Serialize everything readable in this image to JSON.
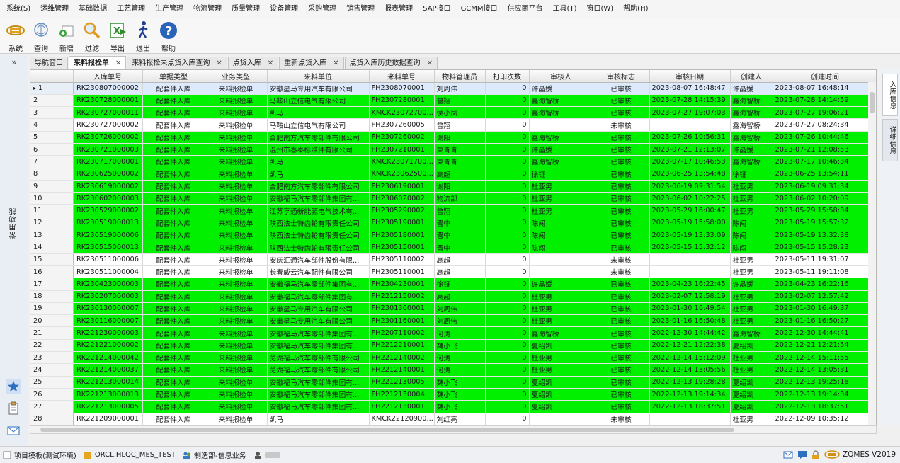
{
  "menu": [
    "系统(S)",
    "运维管理",
    "基础数据",
    "工艺管理",
    "生产管理",
    "物流管理",
    "质量管理",
    "设备管理",
    "采购管理",
    "销售管理",
    "报表管理",
    "SAP接口",
    "GCMM接口",
    "供应商平台",
    "工具(T)",
    "窗口(W)",
    "帮助(H)"
  ],
  "toolbar": [
    {
      "label": "系统",
      "icon": "system-icon"
    },
    {
      "label": "查询",
      "icon": "query-icon"
    },
    {
      "label": "新增",
      "icon": "add-icon"
    },
    {
      "label": "过滤",
      "icon": "filter-icon"
    },
    {
      "label": "导出",
      "icon": "export-icon"
    },
    {
      "label": "退出",
      "icon": "exit-icon"
    },
    {
      "label": "帮助",
      "icon": "help-icon"
    }
  ],
  "sidebar": {
    "expand": "»",
    "title": "常用功能"
  },
  "tabs": [
    {
      "label": "导航窗口",
      "closable": false,
      "active": false
    },
    {
      "label": "来料报检单",
      "closable": true,
      "active": true
    },
    {
      "label": "来料报检未点货入库查询",
      "closable": true,
      "active": false
    },
    {
      "label": "点货入库",
      "closable": true,
      "active": false
    },
    {
      "label": "重新点货入库",
      "closable": true,
      "active": false
    },
    {
      "label": "点货入库历史数据查询",
      "closable": true,
      "active": false
    }
  ],
  "grid": {
    "columns": [
      "",
      "入库单号",
      "单据类型",
      "业务类型",
      "来料单位",
      "来料单号",
      "物料管理员",
      "打印次数",
      "审核人",
      "审核标志",
      "审核日期",
      "创建人",
      "创建时间"
    ],
    "rows": [
      {
        "n": "1",
        "id": "RK230807000002",
        "type": "配套件入库",
        "biz": "来料报检单",
        "unit": "安徽星马专用汽车有限公司",
        "src": "FH2308070001",
        "mgr": "刘周伟",
        "prints": "0",
        "auditor": "许晶媛",
        "flag": "已审核",
        "adate": "2023-08-07 16:48:47",
        "creator": "许晶媛",
        "ctime": "2023-08-07 16:48:14",
        "state": "selected"
      },
      {
        "n": "2",
        "id": "RK230728000001",
        "type": "配套件入库",
        "biz": "来料报检单",
        "unit": "马鞍山立信电气有限公司",
        "src": "FH2307280001",
        "mgr": "曾翔",
        "prints": "0",
        "auditor": "鑫海智桥",
        "flag": "已审核",
        "adate": "2023-07-28 14:15:39",
        "creator": "鑫海智桥",
        "ctime": "2023-07-28 14:14:59",
        "state": "green"
      },
      {
        "n": "3",
        "id": "RK230727000011",
        "type": "配套件入库",
        "biz": "来料报检单",
        "unit": "凯马",
        "src": "KMCK23072700...",
        "mgr": "侯小凤",
        "prints": "0",
        "auditor": "鑫海智桥",
        "flag": "已审核",
        "adate": "2023-07-27 19:07:03",
        "creator": "鑫海智桥",
        "ctime": "2023-07-27 19:06:21",
        "state": "green"
      },
      {
        "n": "4",
        "id": "RK230727000002",
        "type": "配套件入库",
        "biz": "来料报检单",
        "unit": "马鞍山立信电气有限公司",
        "src": "FH2307260005",
        "mgr": "曾翔",
        "prints": "0",
        "auditor": "",
        "flag": "未审核",
        "adate": "",
        "creator": "鑫海智桥",
        "ctime": "2023-07-27 08:24:34",
        "state": "white"
      },
      {
        "n": "5",
        "id": "RK230726000002",
        "type": "配套件入库",
        "biz": "来料报检单",
        "unit": "合肥南方汽车零部件有限公司",
        "src": "FH2307260002",
        "mgr": "谢阳",
        "prints": "0",
        "auditor": "鑫海智桥",
        "flag": "已审核",
        "adate": "2023-07-26 10:56:31",
        "creator": "鑫海智桥",
        "ctime": "2023-07-26 10:44:46",
        "state": "green"
      },
      {
        "n": "6",
        "id": "RK230721000003",
        "type": "配套件入库",
        "biz": "来料报检单",
        "unit": "温州市春泰标准件有限公司",
        "src": "FH2307210001",
        "mgr": "束青青",
        "prints": "0",
        "auditor": "许晶媛",
        "flag": "已审核",
        "adate": "2023-07-21 12:13:07",
        "creator": "许晶媛",
        "ctime": "2023-07-21 12:08:53",
        "state": "green"
      },
      {
        "n": "7",
        "id": "RK230717000001",
        "type": "配套件入库",
        "biz": "来料报检单",
        "unit": "凯马",
        "src": "KMCK23071700...",
        "mgr": "束青青",
        "prints": "0",
        "auditor": "鑫海智桥",
        "flag": "已审核",
        "adate": "2023-07-17 10:46:53",
        "creator": "鑫海智桥",
        "ctime": "2023-07-17 10:46:34",
        "state": "green"
      },
      {
        "n": "8",
        "id": "RK230625000002",
        "type": "配套件入库",
        "biz": "来料报检单",
        "unit": "凯马",
        "src": "KMCK23062500...",
        "mgr": "高超",
        "prints": "0",
        "auditor": "徐钲",
        "flag": "已审核",
        "adate": "2023-06-25 13:54:48",
        "creator": "徐钲",
        "ctime": "2023-06-25 13:54:11",
        "state": "green"
      },
      {
        "n": "9",
        "id": "RK230619000002",
        "type": "配套件入库",
        "biz": "来料报检单",
        "unit": "合肥南方汽车零部件有限公司",
        "src": "FH2306190001",
        "mgr": "谢阳",
        "prints": "0",
        "auditor": "杜亚男",
        "flag": "已审核",
        "adate": "2023-06-19 09:31:54",
        "creator": "杜亚男",
        "ctime": "2023-06-19 09:31:34",
        "state": "green"
      },
      {
        "n": "10",
        "id": "RK230602000003",
        "type": "配套件入库",
        "biz": "来料报检单",
        "unit": "安徽福马汽车零部件集团有...",
        "src": "FH2306020002",
        "mgr": "物流部",
        "prints": "0",
        "auditor": "杜亚男",
        "flag": "已审核",
        "adate": "2023-06-02 10:22:25",
        "creator": "杜亚男",
        "ctime": "2023-06-02 10:20:09",
        "state": "green"
      },
      {
        "n": "11",
        "id": "RK230529000002",
        "type": "配套件入库",
        "biz": "来料报检单",
        "unit": "江苏亨通新能源电气技术有...",
        "src": "FH2305290002",
        "mgr": "曾翔",
        "prints": "0",
        "auditor": "杜亚男",
        "flag": "已审核",
        "adate": "2023-05-29 16:00:47",
        "creator": "杜亚男",
        "ctime": "2023-05-29 15:58:34",
        "state": "green"
      },
      {
        "n": "12",
        "id": "RK230519000013",
        "type": "配套件入库",
        "biz": "来料报检单",
        "unit": "陕西法士特齿轮有限责任公司",
        "src": "FH2305190001",
        "mgr": "晋中",
        "prints": "0",
        "auditor": "陈闯",
        "flag": "已审核",
        "adate": "2023-05-19 15:58:00",
        "creator": "陈闯",
        "ctime": "2023-05-19 15:57:32",
        "state": "green"
      },
      {
        "n": "13",
        "id": "RK230519000006",
        "type": "配套件入库",
        "biz": "来料报检单",
        "unit": "陕西法士特齿轮有限责任公司",
        "src": "FH2305180001",
        "mgr": "晋中",
        "prints": "0",
        "auditor": "陈闯",
        "flag": "已审核",
        "adate": "2023-05-19 13:33:09",
        "creator": "陈闯",
        "ctime": "2023-05-19 13:32:38",
        "state": "green"
      },
      {
        "n": "14",
        "id": "RK230515000013",
        "type": "配套件入库",
        "biz": "来料报检单",
        "unit": "陕西法士特齿轮有限责任公司",
        "src": "FH2305150001",
        "mgr": "晋中",
        "prints": "0",
        "auditor": "陈闯",
        "flag": "已审核",
        "adate": "2023-05-15 15:32:12",
        "creator": "陈闯",
        "ctime": "2023-05-15 15:28:23",
        "state": "green"
      },
      {
        "n": "15",
        "id": "RK230511000006",
        "type": "配套件入库",
        "biz": "来料报检单",
        "unit": "安庆汇通汽车部件股份有限...",
        "src": "FH2305110002",
        "mgr": "高超",
        "prints": "0",
        "auditor": "",
        "flag": "未审核",
        "adate": "",
        "creator": "杜亚男",
        "ctime": "2023-05-11 19:31:07",
        "state": "white"
      },
      {
        "n": "16",
        "id": "RK230511000004",
        "type": "配套件入库",
        "biz": "来料报检单",
        "unit": "长春威云汽车配件有限公司",
        "src": "FH2305110001",
        "mgr": "高超",
        "prints": "0",
        "auditor": "",
        "flag": "未审核",
        "adate": "",
        "creator": "杜亚男",
        "ctime": "2023-05-11 19:11:08",
        "state": "white"
      },
      {
        "n": "17",
        "id": "RK230423000003",
        "type": "配套件入库",
        "biz": "来料报检单",
        "unit": "安徽福马汽车零部件集团有...",
        "src": "FH2304230001",
        "mgr": "徐钲",
        "prints": "0",
        "auditor": "许晶媛",
        "flag": "已审核",
        "adate": "2023-04-23 16:22:45",
        "creator": "许晶媛",
        "ctime": "2023-04-23 16:22:16",
        "state": "green"
      },
      {
        "n": "18",
        "id": "RK230207000003",
        "type": "配套件入库",
        "biz": "来料报检单",
        "unit": "安徽福马汽车零部件集团有...",
        "src": "FH2212150002",
        "mgr": "高超",
        "prints": "0",
        "auditor": "杜亚男",
        "flag": "已审核",
        "adate": "2023-02-07 12:58:19",
        "creator": "杜亚男",
        "ctime": "2023-02-07 12:57:42",
        "state": "green"
      },
      {
        "n": "19",
        "id": "RK230130000007",
        "type": "配套件入库",
        "biz": "来料报检单",
        "unit": "安徽星马专用汽车有限公司",
        "src": "FH2301300001",
        "mgr": "刘周伟",
        "prints": "0",
        "auditor": "杜亚男",
        "flag": "已审核",
        "adate": "2023-01-30 16:49:54",
        "creator": "杜亚男",
        "ctime": "2023-01-30 16:49:37",
        "state": "green"
      },
      {
        "n": "20",
        "id": "RK230116000007",
        "type": "配套件入库",
        "biz": "来料报检单",
        "unit": "安徽星马专用汽车有限公司",
        "src": "FH2301160001",
        "mgr": "刘周伟",
        "prints": "0",
        "auditor": "杜亚男",
        "flag": "已审核",
        "adate": "2023-01-16 16:50:48",
        "creator": "杜亚男",
        "ctime": "2023-01-16 16:50:27",
        "state": "green"
      },
      {
        "n": "21",
        "id": "RK221230000003",
        "type": "配套件入库",
        "biz": "来料报检单",
        "unit": "安徽福马汽车零部件集团有...",
        "src": "FH2207110002",
        "mgr": "何涛",
        "prints": "0",
        "auditor": "鑫海智桥",
        "flag": "已审核",
        "adate": "2022-12-30 14:44:42",
        "creator": "鑫海智桥",
        "ctime": "2022-12-30 14:44:41",
        "state": "green"
      },
      {
        "n": "22",
        "id": "RK221221000002",
        "type": "配套件入库",
        "biz": "来料报检单",
        "unit": "安徽福马汽车零部件集团有...",
        "src": "FH2212210001",
        "mgr": "魏小飞",
        "prints": "0",
        "auditor": "夏绍凯",
        "flag": "已审核",
        "adate": "2022-12-21 12:22:38",
        "creator": "夏绍凯",
        "ctime": "2022-12-21 12:21:54",
        "state": "green"
      },
      {
        "n": "23",
        "id": "RK221214000042",
        "type": "配套件入库",
        "biz": "来料报检单",
        "unit": "芜湖福马汽车零部件有限公司",
        "src": "FH2212140002",
        "mgr": "何涛",
        "prints": "0",
        "auditor": "杜亚男",
        "flag": "已审核",
        "adate": "2022-12-14 15:12:09",
        "creator": "杜亚男",
        "ctime": "2022-12-14 15:11:55",
        "state": "green"
      },
      {
        "n": "24",
        "id": "RK221214000037",
        "type": "配套件入库",
        "biz": "来料报检单",
        "unit": "芜湖福马汽车零部件有限公司",
        "src": "FH2212140001",
        "mgr": "何涛",
        "prints": "0",
        "auditor": "杜亚男",
        "flag": "已审核",
        "adate": "2022-12-14 13:05:56",
        "creator": "杜亚男",
        "ctime": "2022-12-14 13:05:31",
        "state": "green"
      },
      {
        "n": "25",
        "id": "RK221213000014",
        "type": "配套件入库",
        "biz": "来料报检单",
        "unit": "安徽福马汽车零部件集团有...",
        "src": "FH2212130005",
        "mgr": "魏小飞",
        "prints": "0",
        "auditor": "夏绍凯",
        "flag": "已审核",
        "adate": "2022-12-13 19:28:28",
        "creator": "夏绍凯",
        "ctime": "2022-12-13 19:25:18",
        "state": "green"
      },
      {
        "n": "26",
        "id": "RK221213000013",
        "type": "配套件入库",
        "biz": "来料报检单",
        "unit": "安徽福马汽车零部件集团有...",
        "src": "FH2212130004",
        "mgr": "魏小飞",
        "prints": "0",
        "auditor": "夏绍凯",
        "flag": "已审核",
        "adate": "2022-12-13 19:14:34",
        "creator": "夏绍凯",
        "ctime": "2022-12-13 19:14:34",
        "state": "green"
      },
      {
        "n": "27",
        "id": "RK221213000005",
        "type": "配套件入库",
        "biz": "来料报检单",
        "unit": "安徽福马汽车零部件集团有...",
        "src": "FH2212130001",
        "mgr": "魏小飞",
        "prints": "0",
        "auditor": "夏绍凯",
        "flag": "已审核",
        "adate": "2022-12-13 18:37:51",
        "creator": "夏绍凯",
        "ctime": "2022-12-13 18:37:51",
        "state": "green"
      },
      {
        "n": "28",
        "id": "RK221209000001",
        "type": "配套件入库",
        "biz": "来料报检单",
        "unit": "凯马",
        "src": "KMCK22120900...",
        "mgr": "刘红亮",
        "prints": "0",
        "auditor": "",
        "flag": "未审核",
        "adate": "",
        "creator": "杜亚男",
        "ctime": "2022-12-09 10:35:12",
        "state": "white"
      }
    ]
  },
  "right_panel": [
    "入库信息",
    "详细信息"
  ],
  "statusbar": {
    "template": "项目模板(测试环境)",
    "db": "ORCL.HLQC_MES_TEST",
    "dept": "制造部-信息业务",
    "version": "ZQMES V2019"
  },
  "colors": {
    "audited_row": "#00f000",
    "selected_row": "#ddeafc",
    "unaudited_row": "#ffffff"
  }
}
